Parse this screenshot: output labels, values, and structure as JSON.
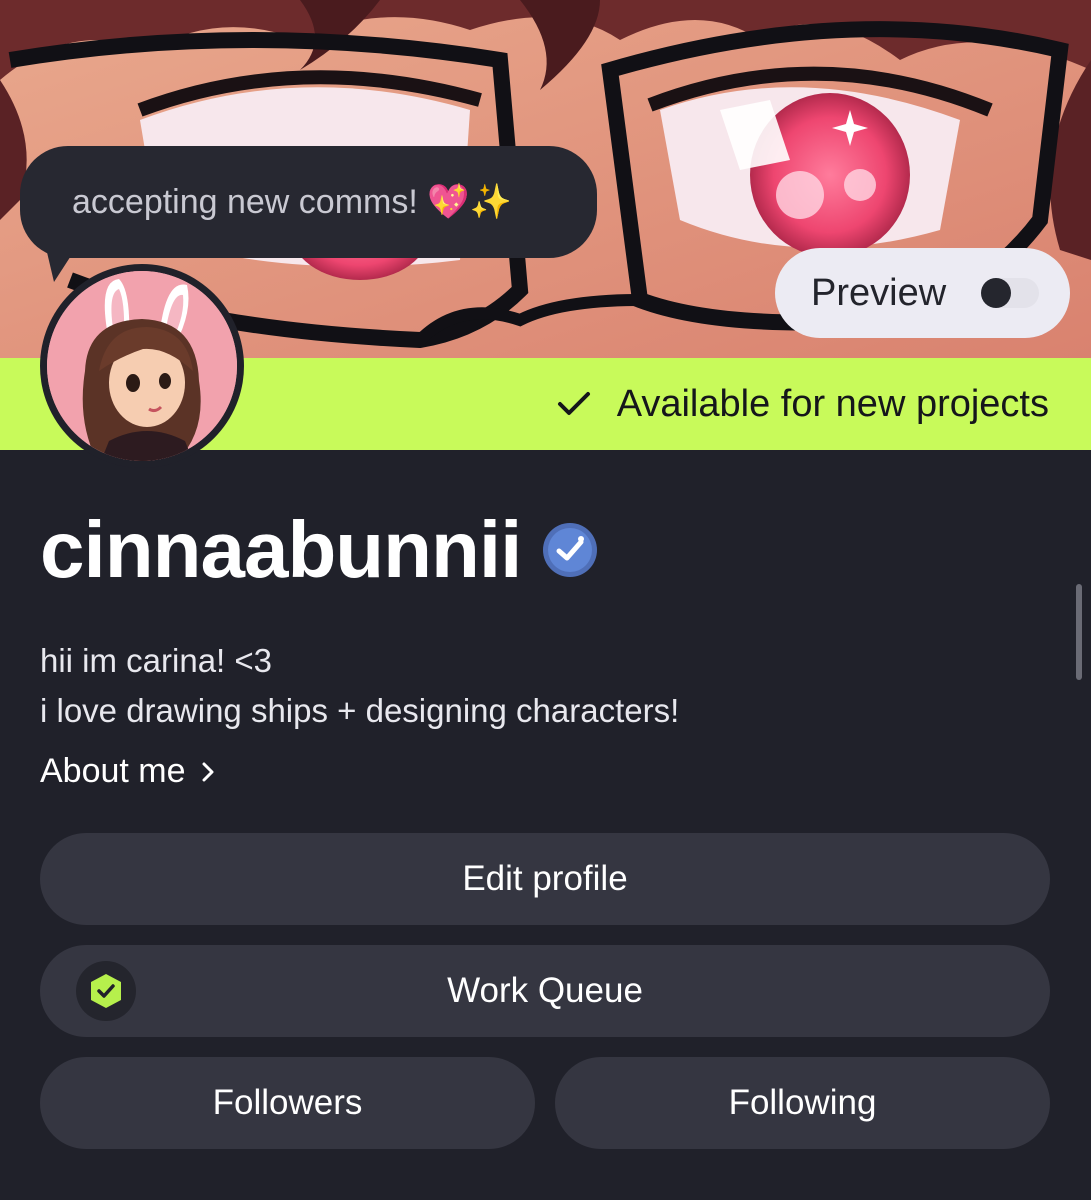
{
  "status": {
    "text": "accepting new comms! 💖✨"
  },
  "preview": {
    "label": "Preview",
    "enabled": false
  },
  "availability": {
    "text": "Available for new projects",
    "color": "#c8fa5a"
  },
  "profile": {
    "username": "cinnaabunnii",
    "verified": true,
    "bio_line_1": "hii im carina! <3",
    "bio_line_2": "i love drawing ships + designing characters!",
    "about_label": "About me"
  },
  "buttons": {
    "edit_profile": "Edit profile",
    "work_queue": "Work Queue",
    "followers": "Followers",
    "following": "Following"
  },
  "icons": {
    "verified": "verified-badge-icon",
    "check": "check-icon",
    "chevron": "chevron-right-icon",
    "queue": "shield-check-icon"
  }
}
